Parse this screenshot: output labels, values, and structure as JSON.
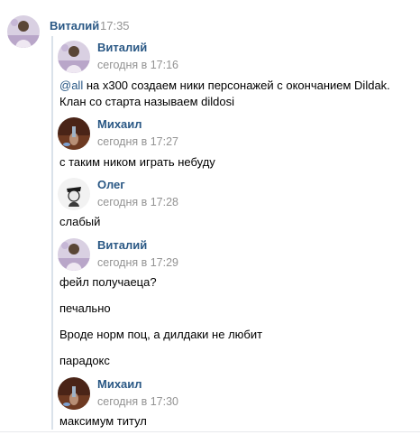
{
  "header": {
    "author": "Виталий",
    "time": "17:35"
  },
  "forwarded": {
    "blocks": [
      {
        "author": "Виталий",
        "time": "сегодня в 17:16",
        "mention": "@all",
        "lines": [
          "на x300 создаем ники персонажей с окончанием Dildak.",
          "Клан со старта называем dildosi"
        ]
      },
      {
        "author": "Михаил",
        "time": "сегодня в 17:27",
        "lines": [
          "с таким ником играть небуду"
        ]
      },
      {
        "author": "Олег",
        "time": "сегодня в 17:28",
        "lines": [
          "слабый"
        ]
      },
      {
        "author": "Виталий",
        "time": "сегодня в 17:29",
        "lines": [
          "фейл получаеца?",
          "печально",
          "Вроде норм поц, а дилдаки не любит",
          "парадокс"
        ]
      },
      {
        "author": "Михаил",
        "time": "сегодня в 17:30",
        "lines": [
          "максимум титул"
        ]
      }
    ]
  },
  "icons": {
    "vitaly_avatar": "user-photo-avatar-icon",
    "mikhail_avatar": "user-photo-avatar-icon",
    "oleg_avatar": "user-photo-avatar-icon"
  },
  "colors": {
    "author_link": "#2a5885",
    "time_gray": "#939393",
    "forward_bar": "#dae2ea"
  }
}
